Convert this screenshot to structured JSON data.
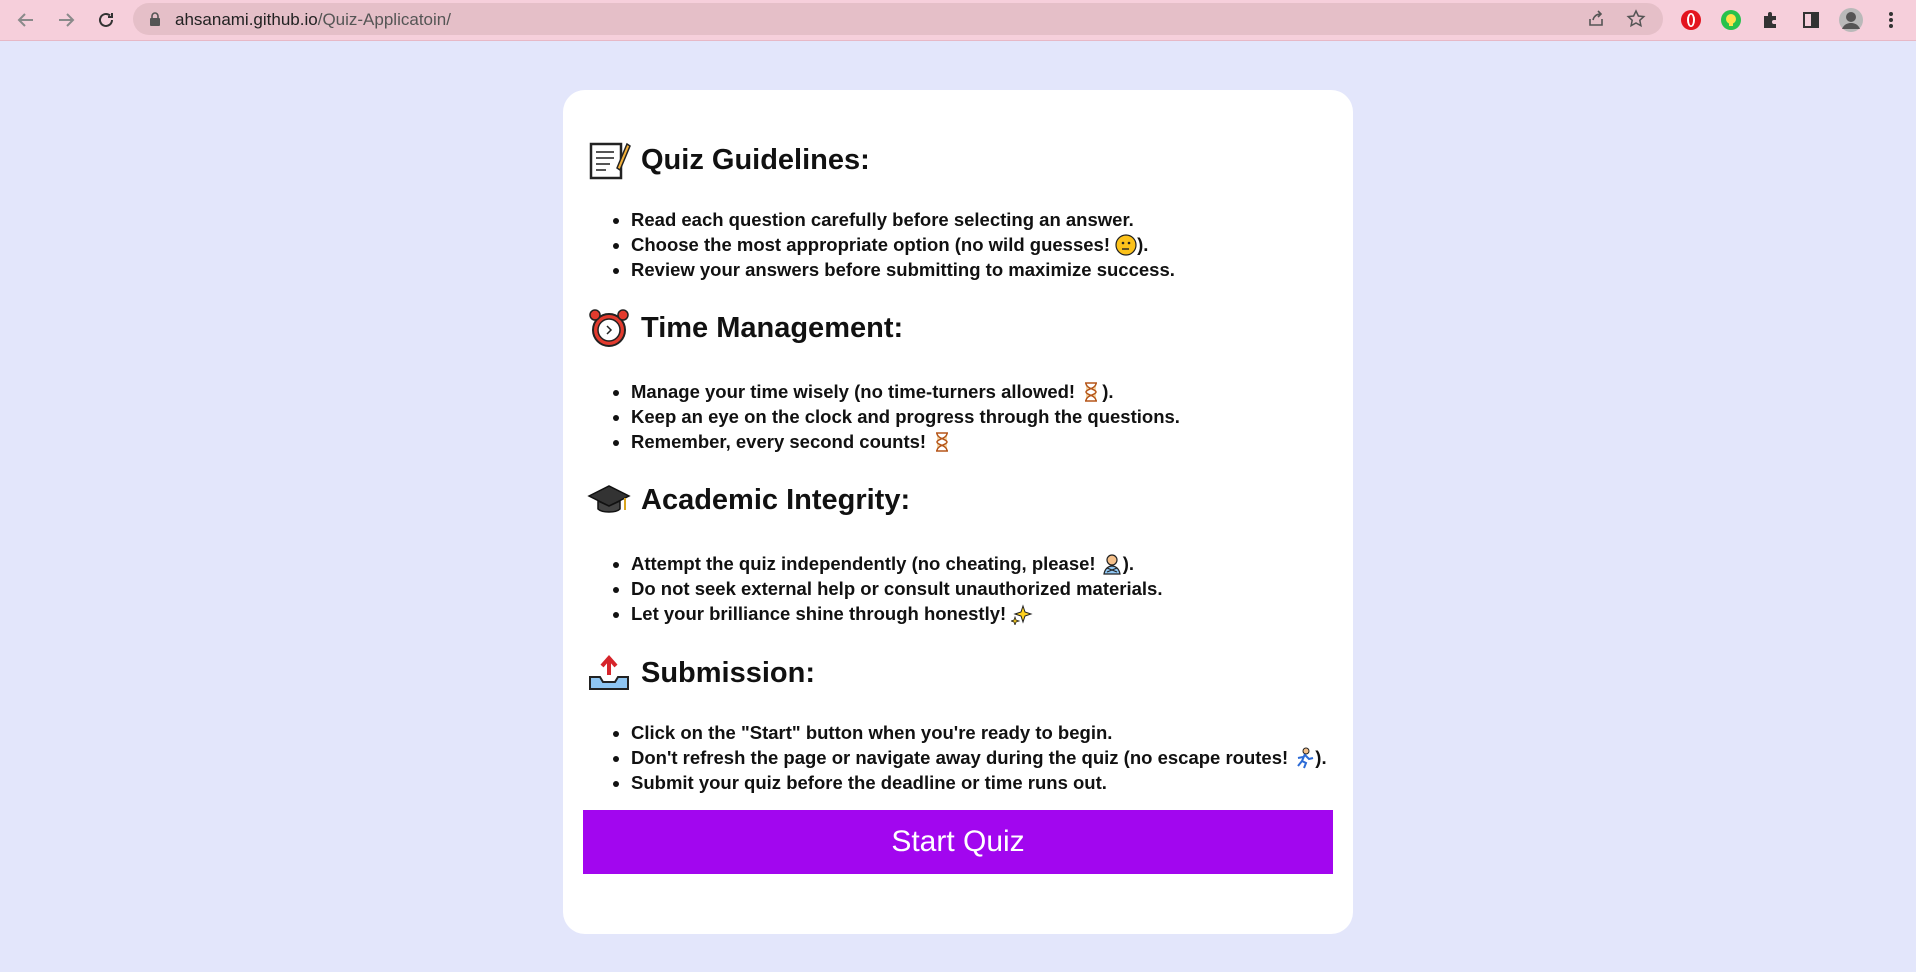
{
  "browser": {
    "url_host": "ahsanami.github.io",
    "url_path": "/Quiz-Applicatoin/",
    "colors": {
      "toolbar": "#f6cfdb",
      "omnibox": "#e5bfc8"
    }
  },
  "sections": [
    {
      "title": "Quiz Guidelines:",
      "icon": "memo-icon",
      "items": [
        {
          "text": "Read each question carefully before selecting an answer."
        },
        {
          "text": "Choose the most appropriate option (no wild guesses! ",
          "emoji": "thinking-face-icon",
          "suffix": ")."
        },
        {
          "text": "Review your answers before submitting to maximize success."
        }
      ]
    },
    {
      "title": "Time Management:",
      "icon": "alarm-clock-icon",
      "items": [
        {
          "text": "Manage your time wisely (no time-turners allowed! ",
          "emoji": "hourglass-icon",
          "suffix": ")."
        },
        {
          "text": "Keep an eye on the clock and progress through the questions."
        },
        {
          "text": "Remember, every second counts! ",
          "emoji": "hourglass-icon",
          "suffix": ""
        }
      ]
    },
    {
      "title": "Academic Integrity:",
      "icon": "graduation-cap-icon",
      "items": [
        {
          "text": "Attempt the quiz independently (no cheating, please! ",
          "emoji": "person-gesturing-no-icon",
          "suffix": ")."
        },
        {
          "text": "Do not seek external help or consult unauthorized materials."
        },
        {
          "text": "Let your brilliance shine through honestly! ",
          "emoji": "sparkles-icon",
          "suffix": ""
        }
      ]
    },
    {
      "title": "Submission:",
      "icon": "outbox-tray-icon",
      "items": [
        {
          "text": "Click on the \"Start\" button when you're ready to begin."
        },
        {
          "text": "Don't refresh the page or navigate away during the quiz (no escape routes! ",
          "emoji": "running-person-icon",
          "suffix": ")."
        },
        {
          "text": "Submit your quiz before the deadline or time runs out."
        }
      ]
    }
  ],
  "start_button": {
    "label": "Start Quiz",
    "color": "#a206ef"
  },
  "page_background": "#e3e6fb"
}
